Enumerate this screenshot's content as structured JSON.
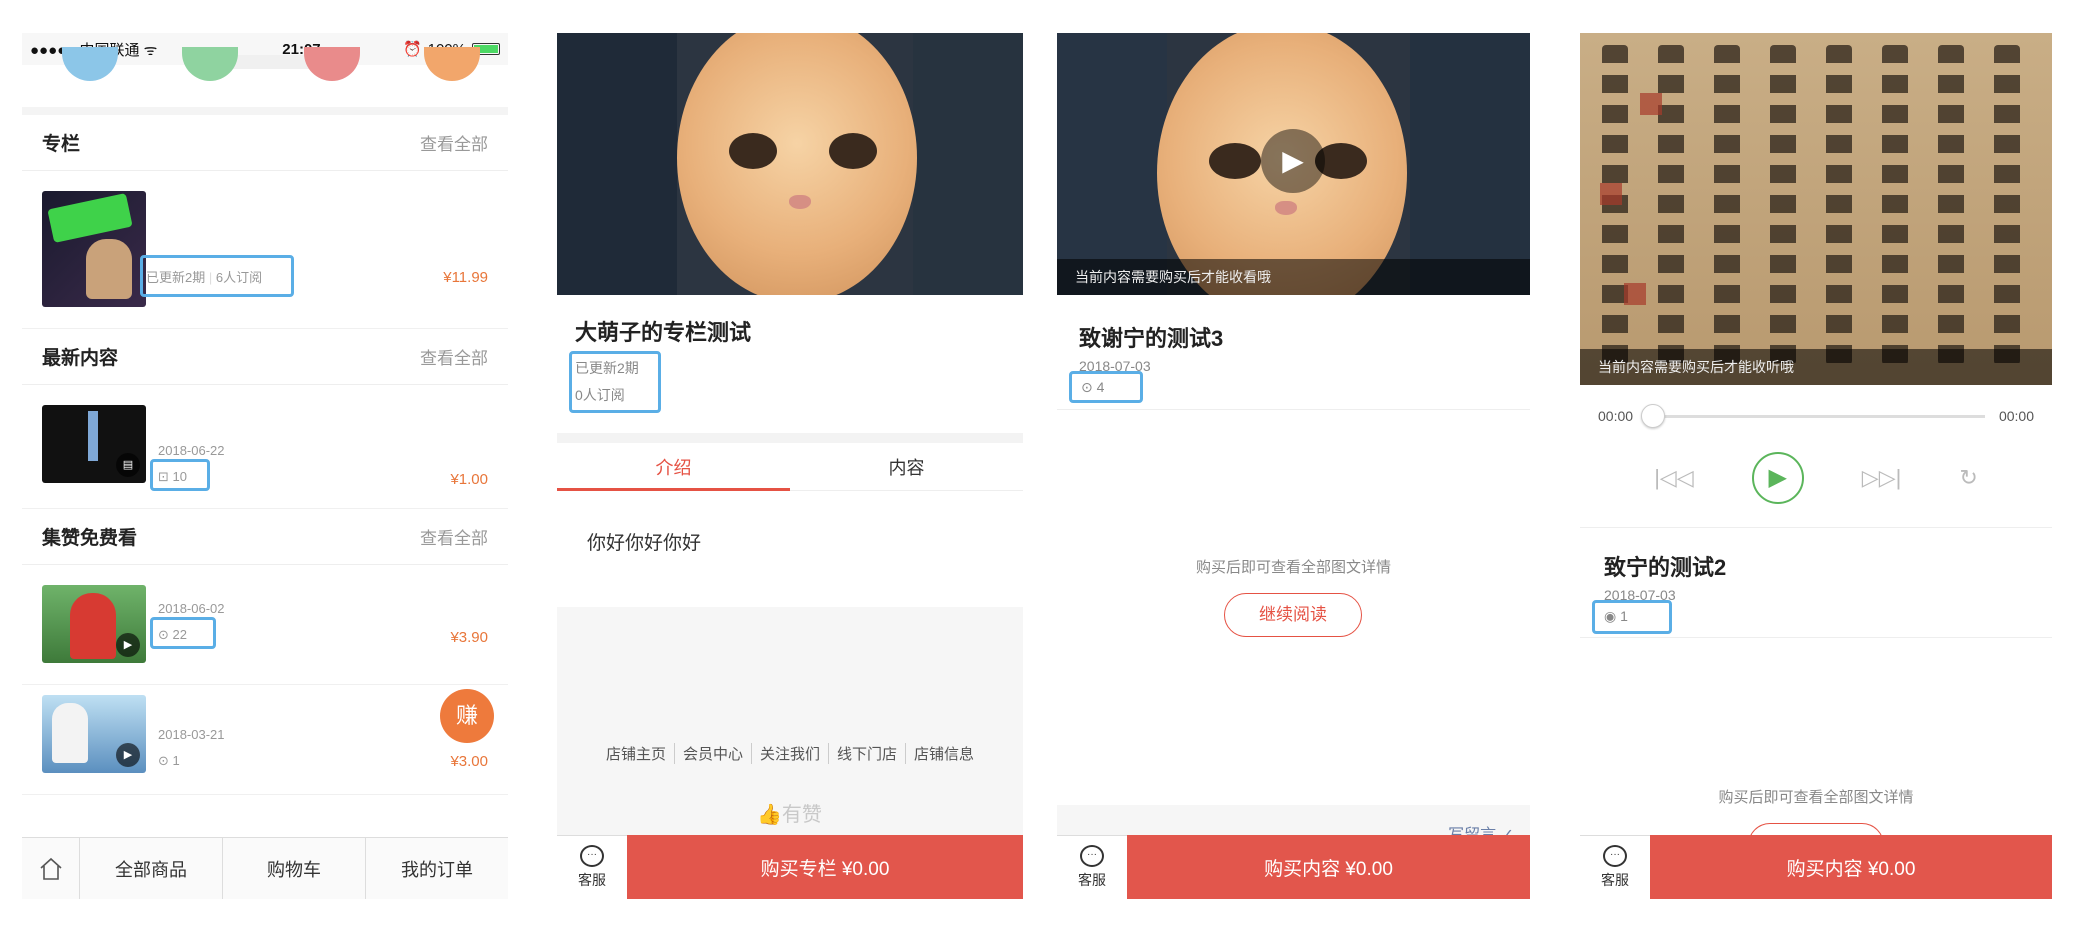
{
  "panel1": {
    "status": {
      "carrier": "●●●●● 中国联通 ᯤ",
      "time": "21:07",
      "battery": "100%"
    },
    "sections": [
      {
        "title": "专栏",
        "more": "查看全部"
      },
      {
        "title": "最新内容",
        "more": "查看全部"
      },
      {
        "title": "集赞免费看",
        "more": "查看全部"
      }
    ],
    "column_item": {
      "updated": "已更新2期",
      "subs": "6人订阅",
      "price": "¥11.99"
    },
    "latest_item": {
      "date": "2018-06-22",
      "count": "10",
      "price": "¥1.00"
    },
    "free_items": [
      {
        "date": "2018-06-02",
        "count": "22",
        "price": "¥3.90"
      },
      {
        "date": "2018-03-21",
        "count": "1",
        "price": "¥3.00"
      }
    ],
    "earn": "赚",
    "tabs": [
      "全部商品",
      "购物车",
      "我的订单"
    ]
  },
  "panel2": {
    "title": "大萌子的专栏测试",
    "updated": "已更新2期",
    "subs": "0人订阅",
    "tabs": [
      "介绍",
      "内容"
    ],
    "intro": "你好你好你好",
    "footer_links": [
      "店铺主页",
      "会员中心",
      "关注我们",
      "线下门店",
      "店铺信息"
    ],
    "youzan": "有赞",
    "cs": "客服",
    "buy": "购买专栏 ¥0.00"
  },
  "panel3": {
    "overlay": "当前内容需要购买后才能收看哦",
    "title": "致谢宁的测试3",
    "date": "2018-07-03",
    "count": "4",
    "note": "购买后即可查看全部图文详情",
    "continue": "继续阅读",
    "write_msg": "写留言 ✓",
    "cs": "客服",
    "buy": "购买内容 ¥0.00"
  },
  "panel4": {
    "overlay": "当前内容需要购买后才能收听哦",
    "time_start": "00:00",
    "time_end": "00:00",
    "title": "致宁的测试2",
    "date": "2018-07-03",
    "count": "1",
    "note": "购买后即可查看全部图文详情",
    "cs": "客服",
    "buy": "购买内容 ¥0.00"
  },
  "colors": {
    "accent_red": "#e2564c",
    "price_orange": "#e8763a",
    "highlight_blue": "#5aaee6",
    "play_green": "#5bb55b"
  }
}
